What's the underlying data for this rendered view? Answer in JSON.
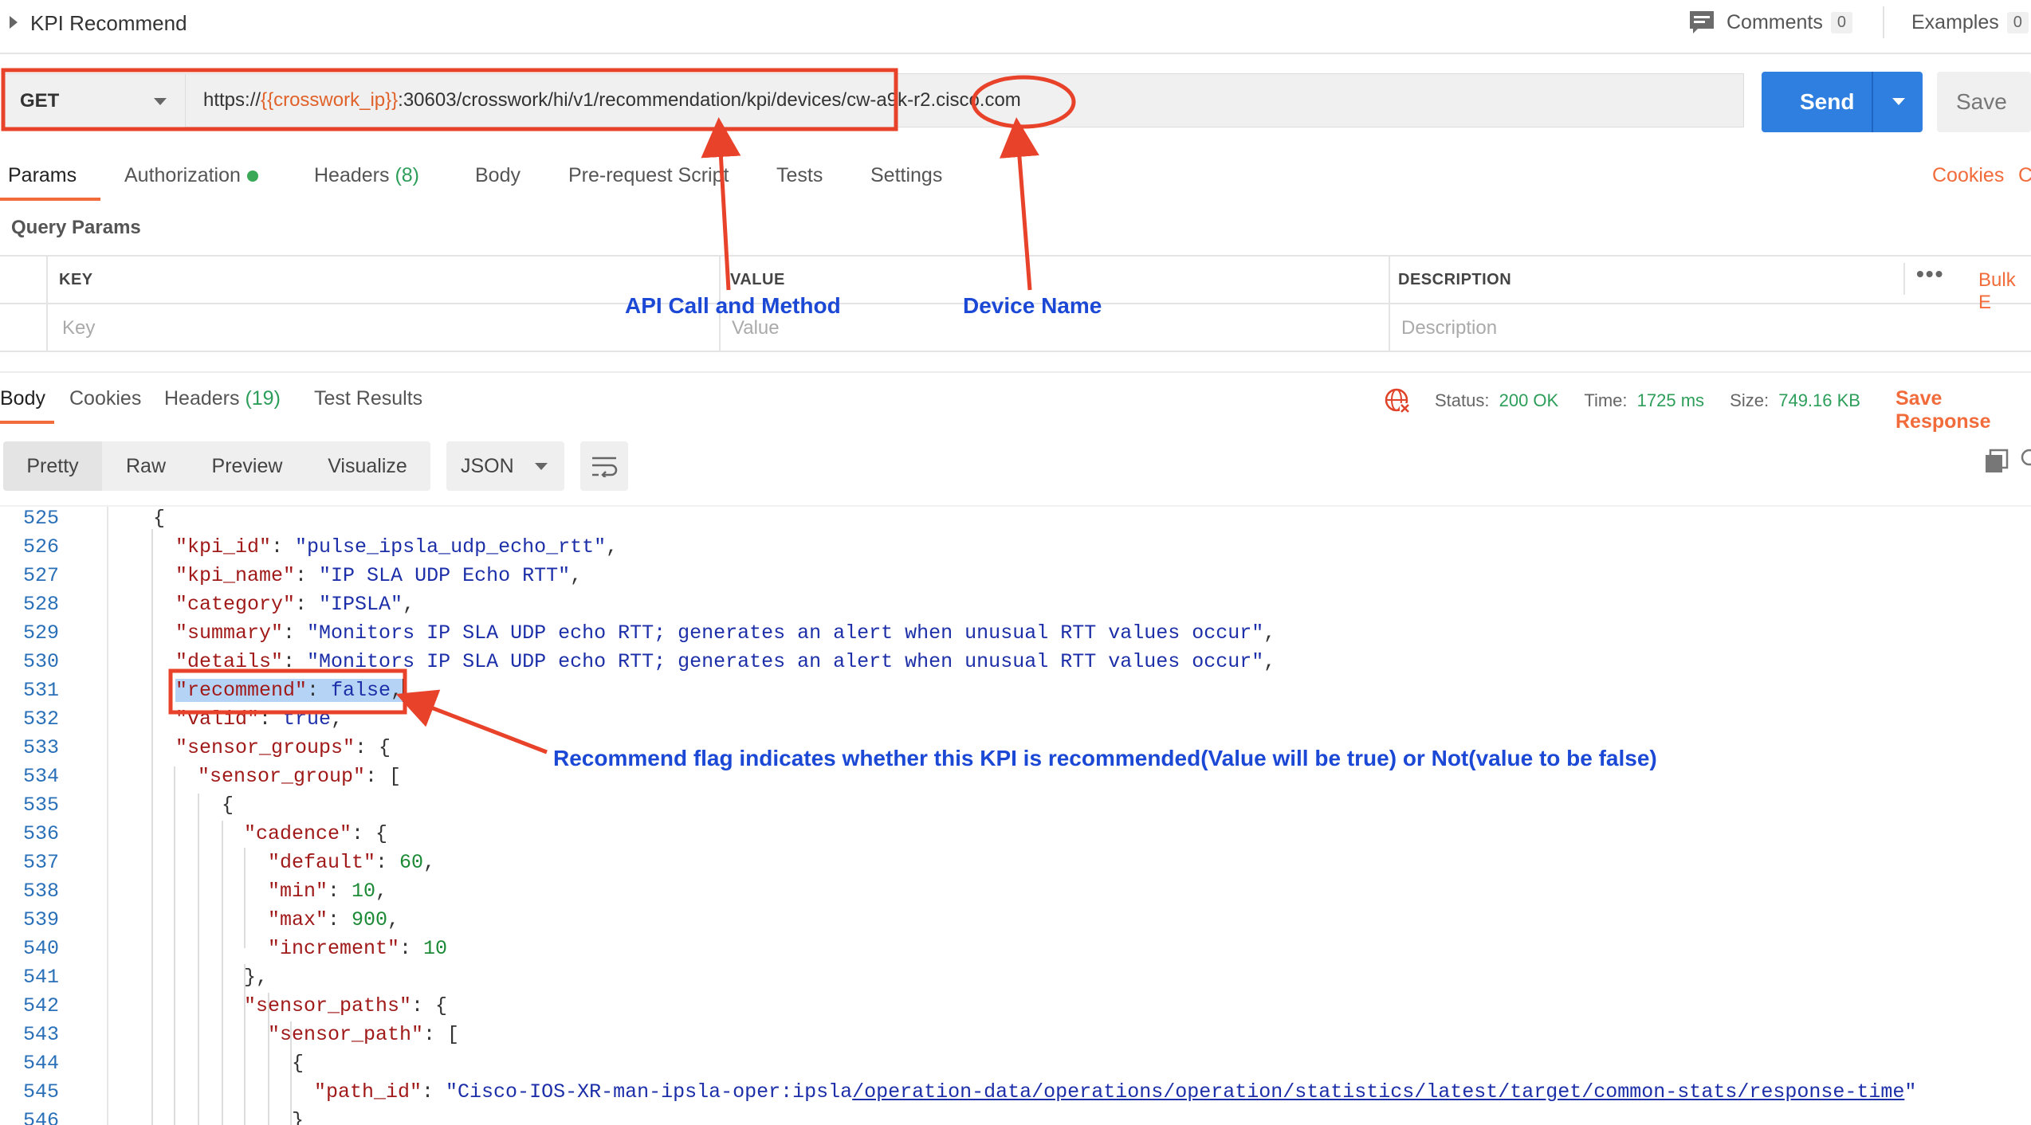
{
  "header": {
    "title": "KPI Recommend",
    "comments_label": "Comments",
    "comments_count": "0",
    "examples_label": "Examples",
    "examples_count": "0"
  },
  "request": {
    "method": "GET",
    "url_prefix": "https://",
    "url_var": "{{crosswork_ip}}",
    "url_path": ":30603/crosswork/hi/v1/recommendation/kpi/devices/",
    "url_device": "cw-a9k-r2.cisco.com",
    "send_label": "Send",
    "save_label": "Save"
  },
  "request_tabs": {
    "params": "Params",
    "authorization": "Authorization",
    "headers": "Headers",
    "headers_count": "(8)",
    "body": "Body",
    "prerequest": "Pre-request Script",
    "tests": "Tests",
    "settings": "Settings",
    "cookies": "Cookies",
    "code_partial": "C"
  },
  "query_params": {
    "section_title": "Query Params",
    "col_key": "KEY",
    "col_value": "VALUE",
    "col_description": "DESCRIPTION",
    "bulk_edit": "Bulk E",
    "key_placeholder": "Key",
    "value_placeholder": "Value",
    "description_placeholder": "Description"
  },
  "response": {
    "tabs": {
      "body": "Body",
      "cookies": "Cookies",
      "headers": "Headers",
      "headers_count": "(19)",
      "test_results": "Test Results"
    },
    "status_label": "Status:",
    "status_value": "200 OK",
    "time_label": "Time:",
    "time_value": "1725 ms",
    "size_label": "Size:",
    "size_value": "749.16 KB",
    "save_response": "Save Response"
  },
  "view": {
    "pretty": "Pretty",
    "raw": "Raw",
    "preview": "Preview",
    "visualize": "Visualize",
    "format": "JSON"
  },
  "code": {
    "line_numbers": [
      "525",
      "526",
      "527",
      "528",
      "529",
      "530",
      "531",
      "532",
      "533",
      "534",
      "535",
      "536",
      "537",
      "538",
      "539",
      "540",
      "541",
      "542",
      "543",
      "544",
      "545",
      "546"
    ],
    "kpi_id_key": "\"kpi_id\"",
    "kpi_id_val": "\"pulse_ipsla_udp_echo_rtt\"",
    "kpi_name_key": "\"kpi_name\"",
    "kpi_name_val": "\"IP SLA UDP Echo RTT\"",
    "category_key": "\"category\"",
    "category_val": "\"IPSLA\"",
    "summary_key": "\"summary\"",
    "summary_val": "\"Monitors IP SLA UDP echo RTT; generates an alert when unusual RTT values occur\"",
    "details_key": "\"details\"",
    "details_val": "\"Monitors IP SLA UDP echo RTT; generates an alert when unusual RTT values occur\"",
    "recommend_key": "\"recommend\"",
    "recommend_val": "false",
    "valid_key": "\"valid\"",
    "valid_val": "true",
    "sensor_groups_key": "\"sensor_groups\"",
    "sensor_group_key": "\"sensor_group\"",
    "cadence_key": "\"cadence\"",
    "default_key": "\"default\"",
    "default_val": "60",
    "min_key": "\"min\"",
    "min_val": "10",
    "max_key": "\"max\"",
    "max_val": "900",
    "increment_key": "\"increment\"",
    "increment_val": "10",
    "sensor_paths_key": "\"sensor_paths\"",
    "sensor_path_key": "\"sensor_path\"",
    "path_id_key": "\"path_id\"",
    "path_id_val_a": "\"Cisco-IOS-XR-man-ipsla-oper:ipsla",
    "path_id_val_b": "/operation-data/operations/operation/statistics/latest/target/common-stats/response-time",
    "path_id_val_c": "\""
  },
  "annotations": {
    "api_call": "API Call and Method",
    "device_name": "Device Name",
    "recommend_flag": "Recommend flag indicates whether this KPI is recommended(Value will be true) or Not(value to be false)",
    "color": "#e8432a",
    "text_color": "#1c48d6"
  }
}
